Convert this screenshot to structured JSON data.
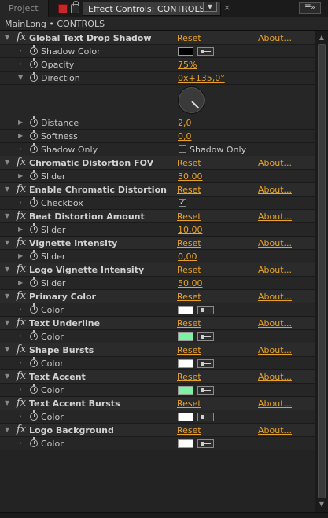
{
  "tabs": {
    "project": "Project",
    "active": "Effect Controls: CONTROLS",
    "dropdown_icon": "chevron-down-icon",
    "close_icon": "close-icon",
    "menu_icon": "panel-menu-icon"
  },
  "breadcrumb": "MainLong • CONTROLS",
  "links": {
    "reset": "Reset",
    "about": "About..."
  },
  "colors": {
    "accent": "#e8a22a",
    "white_swatch": "#ffffff",
    "black_swatch": "#000000",
    "green_swatch": "#7cf2a2"
  },
  "effects": {
    "drop_shadow": {
      "name": "Global Text Drop Shadow",
      "params": {
        "shadow_color": {
          "label": "Shadow Color",
          "color": "#000000"
        },
        "opacity": {
          "label": "Opacity",
          "value": "75%"
        },
        "direction": {
          "label": "Direction",
          "value": "0x+135,0°",
          "angle_deg": 135
        },
        "distance": {
          "label": "Distance",
          "value": "2,0"
        },
        "softness": {
          "label": "Softness",
          "value": "0,0"
        },
        "shadow_only": {
          "label": "Shadow Only",
          "checkbox_label": "Shadow Only",
          "checked": false
        }
      }
    },
    "chromatic_fov": {
      "name": "Chromatic Distortion FOV",
      "param_label": "Slider",
      "value": "30,00"
    },
    "enable_chromatic": {
      "name": "Enable Chromatic Distortion",
      "param_label": "Checkbox",
      "checked": true
    },
    "beat_distortion": {
      "name": "Beat Distortion Amount",
      "param_label": "Slider",
      "value": "10,00"
    },
    "vignette_intensity": {
      "name": "Vignette Intensity",
      "param_label": "Slider",
      "value": "0,00"
    },
    "logo_vignette": {
      "name": "Logo Vignette Intensity",
      "param_label": "Slider",
      "value": "50,00"
    },
    "primary_color": {
      "name": "Primary Color",
      "param_label": "Color",
      "color": "#ffffff"
    },
    "text_underline": {
      "name": "Text Underline",
      "param_label": "Color",
      "color": "#7cf2a2"
    },
    "shape_bursts": {
      "name": "Shape Bursts",
      "param_label": "Color",
      "color": "#ffffff"
    },
    "text_accent": {
      "name": "Text Accent",
      "param_label": "Color",
      "color": "#7cf2a2"
    },
    "text_accent_bursts": {
      "name": "Text Accent Bursts",
      "param_label": "Color",
      "color": "#ffffff"
    },
    "logo_background": {
      "name": "Logo Background",
      "param_label": "Color",
      "color": "#ffffff"
    }
  }
}
